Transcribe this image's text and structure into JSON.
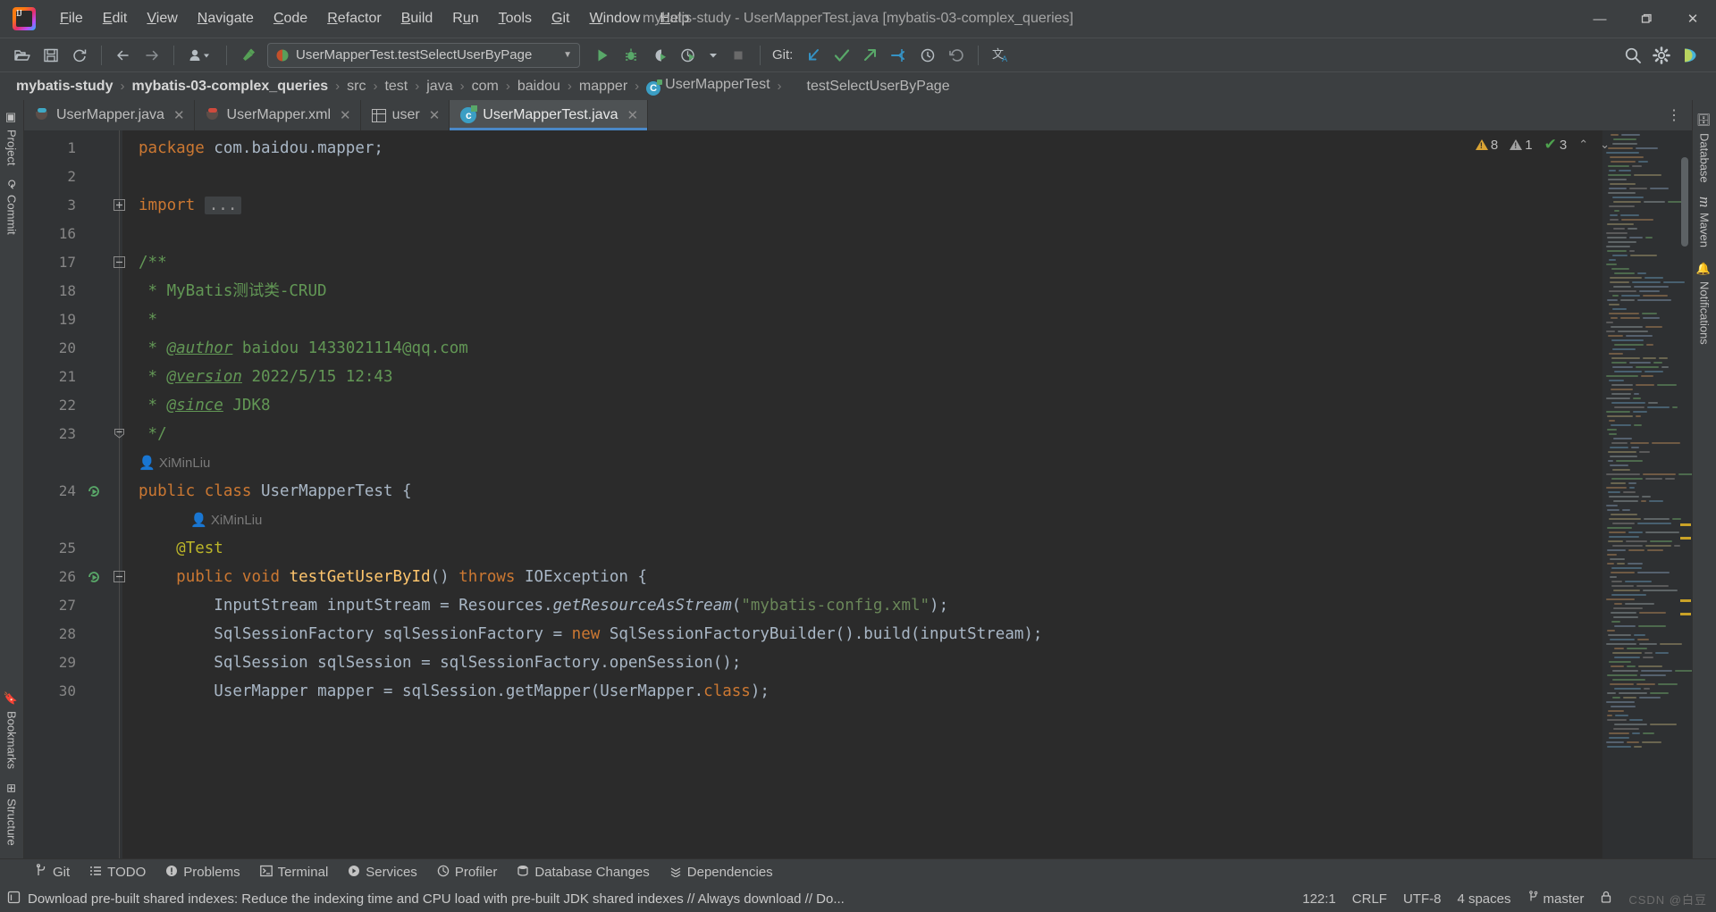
{
  "titlebar": {
    "app_icon": "intellij-logo",
    "title": "mybatis-study - UserMapperTest.java [mybatis-03-complex_queries]",
    "menus": [
      {
        "label": "File",
        "mnemonic": "F"
      },
      {
        "label": "Edit",
        "mnemonic": "E"
      },
      {
        "label": "View",
        "mnemonic": "V"
      },
      {
        "label": "Navigate",
        "mnemonic": "N"
      },
      {
        "label": "Code",
        "mnemonic": "C"
      },
      {
        "label": "Refactor",
        "mnemonic": "R"
      },
      {
        "label": "Build",
        "mnemonic": "B"
      },
      {
        "label": "Run",
        "mnemonic": "u"
      },
      {
        "label": "Tools",
        "mnemonic": "T"
      },
      {
        "label": "Git",
        "mnemonic": "G"
      },
      {
        "label": "Window",
        "mnemonic": "W"
      },
      {
        "label": "Help",
        "mnemonic": "H"
      }
    ],
    "window_controls": {
      "minimize": "—",
      "maximize": "❐",
      "close": "✕"
    }
  },
  "toolbar": {
    "run_configuration": "UserMapperTest.testSelectUserByPage",
    "run_config_dropdown": "▼",
    "git_label": "Git:",
    "buttons": [
      "open-project-icon",
      "save-all-icon",
      "sync-refresh-icon",
      "navigate-back-icon",
      "navigate-forward-icon",
      "profile-dropdown-icon",
      "build-hammer-icon",
      "run-icon",
      "debug-icon",
      "run-coverage-icon",
      "run-profiler-icon",
      "stop-icon",
      "git-update-icon",
      "git-commit-icon",
      "git-push-icon",
      "git-branches-icon",
      "git-history-icon",
      "undo-icon",
      "translate-icon",
      "search-everywhere-icon",
      "settings-gear-icon",
      "ide-assistant-icon"
    ]
  },
  "breadcrumb": {
    "items": [
      {
        "label": "mybatis-study",
        "bold": true,
        "icon": null
      },
      {
        "label": "mybatis-03-complex_queries",
        "bold": true,
        "icon": null
      },
      {
        "label": "src",
        "bold": false,
        "icon": null
      },
      {
        "label": "test",
        "bold": false,
        "icon": null
      },
      {
        "label": "java",
        "bold": false,
        "icon": null
      },
      {
        "label": "com",
        "bold": false,
        "icon": null
      },
      {
        "label": "baidou",
        "bold": false,
        "icon": null
      },
      {
        "label": "mapper",
        "bold": false,
        "icon": null
      },
      {
        "label": "UserMapperTest",
        "bold": false,
        "icon": "class-icon"
      },
      {
        "label": "testSelectUserByPage",
        "bold": false,
        "icon": null
      }
    ],
    "separator": "›"
  },
  "left_rail": {
    "top": [
      {
        "label": "Project",
        "icon": "project-icon"
      },
      {
        "label": "Commit",
        "icon": "commit-icon"
      }
    ],
    "bottom": [
      {
        "label": "Bookmarks",
        "icon": "bookmark-icon"
      },
      {
        "label": "Structure",
        "icon": "structure-icon"
      }
    ]
  },
  "right_rail": {
    "items": [
      {
        "label": "Database",
        "icon": "database-icon"
      },
      {
        "label": "Maven",
        "icon": "maven-icon"
      },
      {
        "label": "Notifications",
        "icon": "notifications-icon"
      }
    ]
  },
  "editor_tabs": {
    "tabs": [
      {
        "label": "UserMapper.java",
        "icon": "java-file-icon",
        "active": false,
        "close": "✕"
      },
      {
        "label": "UserMapper.xml",
        "icon": "xml-file-icon",
        "active": false,
        "close": "✕"
      },
      {
        "label": "user",
        "icon": "db-table-icon",
        "active": false,
        "close": "✕"
      },
      {
        "label": "UserMapperTest.java",
        "icon": "test-class-icon",
        "active": true,
        "close": "✕"
      }
    ],
    "more": "⋮"
  },
  "inspections": {
    "warnings_count": "8",
    "weak_warnings_count": "1",
    "ok_count": "3",
    "up": "⌃",
    "down": "⌄"
  },
  "editor": {
    "lines": [
      {
        "number": "1",
        "indent": 0,
        "type": "code",
        "tokens": [
          {
            "t": "package ",
            "c": "kw"
          },
          {
            "t": "com.baidou.mapper;",
            "c": "pl"
          }
        ]
      },
      {
        "number": "2",
        "indent": 0,
        "type": "code",
        "tokens": []
      },
      {
        "number": "3",
        "indent": 0,
        "type": "code",
        "fold": "+",
        "tokens": [
          {
            "t": "import ",
            "c": "kw"
          },
          {
            "t": "...",
            "c": "fold-ph"
          }
        ]
      },
      {
        "number": "16",
        "indent": 0,
        "type": "code",
        "tokens": []
      },
      {
        "number": "17",
        "indent": 0,
        "type": "code",
        "fold": "-",
        "tokens": [
          {
            "t": "/**",
            "c": "cm"
          }
        ]
      },
      {
        "number": "18",
        "indent": 0,
        "type": "code",
        "tokens": [
          {
            "t": " * MyBatis测试类-CRUD",
            "c": "cm"
          }
        ]
      },
      {
        "number": "19",
        "indent": 0,
        "type": "code",
        "tokens": [
          {
            "t": " *",
            "c": "cm"
          }
        ]
      },
      {
        "number": "20",
        "indent": 0,
        "type": "code",
        "tokens": [
          {
            "t": " * ",
            "c": "cm"
          },
          {
            "t": "@author",
            "c": "cm-tag"
          },
          {
            "t": " baidou 1433021114@qq.com",
            "c": "cm"
          }
        ]
      },
      {
        "number": "21",
        "indent": 0,
        "type": "code",
        "tokens": [
          {
            "t": " * ",
            "c": "cm"
          },
          {
            "t": "@version",
            "c": "cm-tag"
          },
          {
            "t": " 2022/5/15 12:43",
            "c": "cm"
          }
        ]
      },
      {
        "number": "22",
        "indent": 0,
        "type": "code",
        "tokens": [
          {
            "t": " * ",
            "c": "cm"
          },
          {
            "t": "@since",
            "c": "cm-tag"
          },
          {
            "t": " JDK8",
            "c": "cm"
          }
        ]
      },
      {
        "number": "23",
        "indent": 0,
        "type": "code",
        "fold": "⌂",
        "tokens": [
          {
            "t": " */",
            "c": "cm"
          }
        ]
      },
      {
        "number": "",
        "indent": 0,
        "type": "inlay",
        "inlay": "XiMinLiu",
        "inlay_indent": 0
      },
      {
        "number": "24",
        "indent": 0,
        "type": "code",
        "runmark": true,
        "tokens": [
          {
            "t": "public class ",
            "c": "kw"
          },
          {
            "t": "UserMapperTest ",
            "c": "pl"
          },
          {
            "t": "{",
            "c": "pl"
          }
        ]
      },
      {
        "number": "",
        "indent": 1,
        "type": "inlay",
        "inlay": "XiMinLiu",
        "inlay_indent": 1
      },
      {
        "number": "25",
        "indent": 1,
        "type": "code",
        "tokens": [
          {
            "t": "    ",
            "c": "pl"
          },
          {
            "t": "@Test",
            "c": "ann"
          }
        ]
      },
      {
        "number": "26",
        "indent": 1,
        "type": "code",
        "runmark": true,
        "fold": "-",
        "tokens": [
          {
            "t": "    ",
            "c": "pl"
          },
          {
            "t": "public void ",
            "c": "kw"
          },
          {
            "t": "testGetUserById",
            "c": "mth"
          },
          {
            "t": "() ",
            "c": "pl"
          },
          {
            "t": "throws ",
            "c": "kw"
          },
          {
            "t": "IOException {",
            "c": "pl"
          }
        ]
      },
      {
        "number": "27",
        "indent": 2,
        "type": "code",
        "tokens": [
          {
            "t": "        InputStream inputStream = Resources.",
            "c": "pl"
          },
          {
            "t": "getResourceAsStream",
            "c": "pl ital"
          },
          {
            "t": "(",
            "c": "pl"
          },
          {
            "t": "\"mybatis-config.xml\"",
            "c": "str"
          },
          {
            "t": ");",
            "c": "pl"
          }
        ]
      },
      {
        "number": "28",
        "indent": 2,
        "type": "code",
        "tokens": [
          {
            "t": "        SqlSessionFactory sqlSessionFactory = ",
            "c": "pl"
          },
          {
            "t": "new ",
            "c": "kw"
          },
          {
            "t": "SqlSessionFactoryBuilder().build(inputStream);",
            "c": "pl"
          }
        ]
      },
      {
        "number": "29",
        "indent": 2,
        "type": "code",
        "tokens": [
          {
            "t": "        SqlSession sqlSession = sqlSessionFactory.openSession();",
            "c": "pl"
          }
        ]
      },
      {
        "number": "30",
        "indent": 2,
        "type": "code",
        "tokens": [
          {
            "t": "        UserMapper mapper = sqlSession.getMapper(UserMapper.",
            "c": "pl"
          },
          {
            "t": "class",
            "c": "kw"
          },
          {
            "t": ");",
            "c": "pl"
          }
        ]
      }
    ]
  },
  "tool_windows": {
    "items": [
      {
        "label": "Git",
        "icon": "git-branch-icon"
      },
      {
        "label": "TODO",
        "icon": "todo-list-icon"
      },
      {
        "label": "Problems",
        "icon": "problems-icon"
      },
      {
        "label": "Terminal",
        "icon": "terminal-icon"
      },
      {
        "label": "Services",
        "icon": "services-icon"
      },
      {
        "label": "Profiler",
        "icon": "profiler-icon"
      },
      {
        "label": "Database Changes",
        "icon": "database-changes-icon"
      },
      {
        "label": "Dependencies",
        "icon": "dependencies-icon"
      }
    ]
  },
  "statusbar": {
    "message": "Download pre-built shared indexes: Reduce the indexing time and CPU load with pre-built JDK shared indexes // Always download // Do...",
    "message_icon": "notification-icon",
    "caret_position": "122:1",
    "line_separator": "CRLF",
    "encoding": "UTF-8",
    "indent": "4 spaces",
    "branch": "master",
    "branch_icon": "git-branch-icon",
    "lock_icon": "read-only-lock-icon",
    "watermark": "CSDN @白豆"
  }
}
